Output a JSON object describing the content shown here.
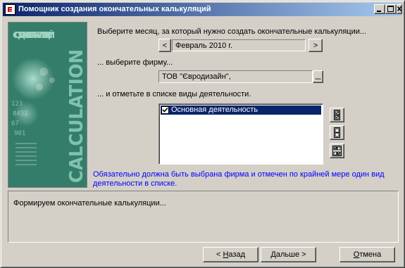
{
  "window": {
    "title": "Помощник создания окончательных калькуляций",
    "icon": "1c-app-icon",
    "controls": [
      "minimize-icon",
      "maximize-icon",
      "close-icon"
    ]
  },
  "side_image": {
    "caption_top": "СОЗДАНИЕ КАЛЬКУЛЯЦИЙ",
    "caption_vertical": "CALCULATION"
  },
  "month": {
    "prompt": "Выберите месяц, за который нужно создать окончательные калькуляции...",
    "value": "Февраль 2010 г.",
    "prev_label": "<",
    "next_label": ">"
  },
  "firm": {
    "prompt": "... выберите фирму...",
    "value": "ТОВ \"Євродизайн\",",
    "select_label": "..."
  },
  "activities": {
    "prompt": "... и отметьте в списке виды деятельности.",
    "items": [
      {
        "label": "Основная деятельность",
        "checked": true,
        "selected": true
      }
    ],
    "side_buttons": [
      "check-all-icon",
      "uncheck-all-icon",
      "invert-check-icon"
    ]
  },
  "note": "Обязательно должна быть выбрана фирма и отмечен по крайней мере один вид деятельности в списке.",
  "status": "Формируем окончательные калькуляции...",
  "buttons": {
    "back": {
      "prefix": "< ",
      "hotkey": "Н",
      "rest": "азад"
    },
    "next": {
      "text": "Дальше >"
    },
    "cancel": {
      "hotkey": "О",
      "rest": "тмена"
    }
  },
  "colors": {
    "titlebar_start": "#0a246a",
    "titlebar_end": "#a6caf0",
    "selection": "#0a246a",
    "note_text": "#0000ff",
    "dialog_bg": "#d4d0c8"
  }
}
